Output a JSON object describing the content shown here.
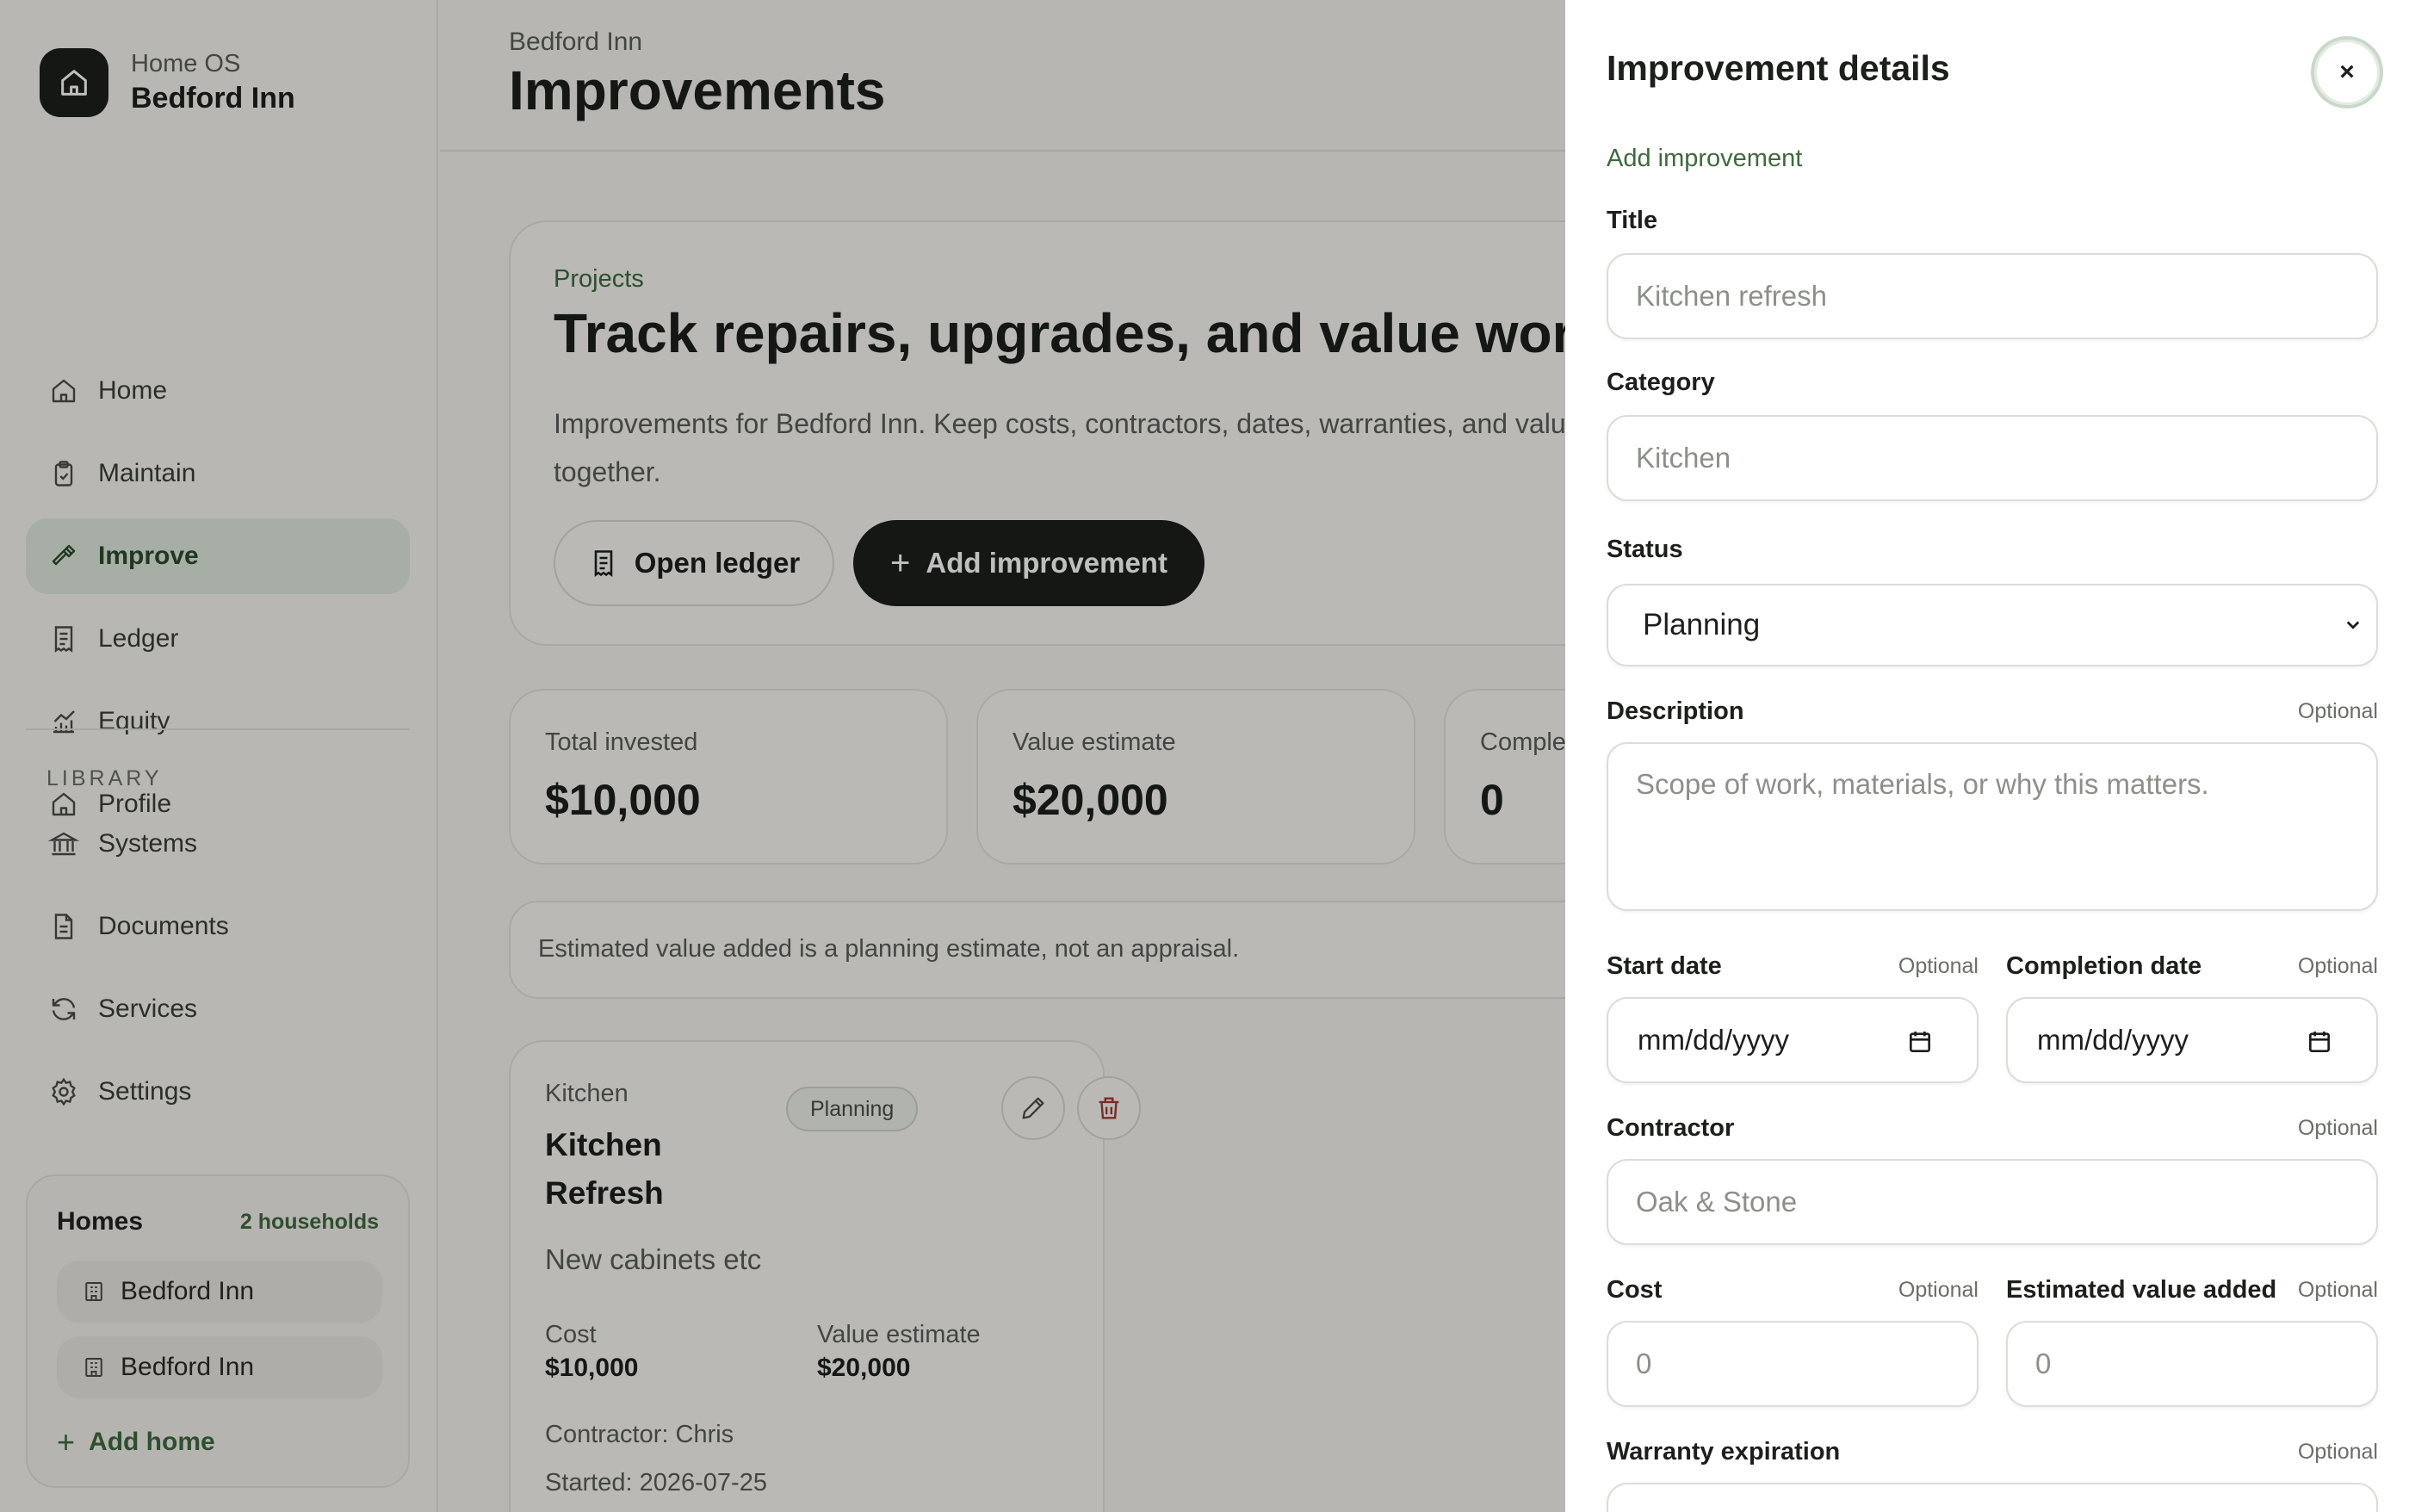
{
  "brand": {
    "kicker": "Home OS",
    "name": "Bedford Inn"
  },
  "nav": {
    "items": [
      {
        "label": "Home",
        "icon": "home-icon"
      },
      {
        "label": "Maintain",
        "icon": "clipboard-icon"
      },
      {
        "label": "Improve",
        "icon": "hammer-icon",
        "active": true
      },
      {
        "label": "Ledger",
        "icon": "receipt-icon"
      },
      {
        "label": "Equity",
        "icon": "chart-icon"
      },
      {
        "label": "Profile",
        "icon": "home-icon"
      }
    ],
    "library_label": "LIBRARY",
    "library": [
      {
        "label": "Systems",
        "icon": "bank-icon"
      },
      {
        "label": "Documents",
        "icon": "document-icon"
      },
      {
        "label": "Services",
        "icon": "refresh-icon"
      },
      {
        "label": "Settings",
        "icon": "gear-icon"
      }
    ]
  },
  "homes": {
    "title": "Homes",
    "count": "2 households",
    "items": [
      "Bedford Inn",
      "Bedford Inn"
    ],
    "add_label": "Add home"
  },
  "header": {
    "breadcrumb": "Bedford Inn",
    "title": "Improvements"
  },
  "hero": {
    "kicker": "Projects",
    "title": "Track repairs, upgrades, and value work.",
    "description": "Improvements for Bedford Inn. Keep costs, contractors, dates, warranties, and value estimates together.",
    "open_ledger_label": "Open ledger",
    "add_label": "Add improvement"
  },
  "stats": [
    {
      "label": "Total invested",
      "value": "$10,000"
    },
    {
      "label": "Value estimate",
      "value": "$20,000"
    },
    {
      "label": "Completed",
      "value": "0"
    }
  ],
  "disclaimer": "Estimated value added is a planning estimate, not an appraisal.",
  "project": {
    "category": "Kitchen",
    "title": "Kitchen Refresh",
    "status": "Planning",
    "description": "New cabinets etc",
    "cost_label": "Cost",
    "cost": "$10,000",
    "value_label": "Value estimate",
    "value": "$20,000",
    "contractor": "Contractor: Chris",
    "started": "Started: 2026-07-25"
  },
  "drawer": {
    "title": "Improvement details",
    "close_label": "×",
    "subtitle": "Add improvement",
    "optional": "Optional",
    "fields": {
      "title": {
        "label": "Title",
        "placeholder": "Kitchen refresh"
      },
      "category": {
        "label": "Category",
        "placeholder": "Kitchen"
      },
      "status": {
        "label": "Status",
        "value": "Planning"
      },
      "description": {
        "label": "Description",
        "placeholder": "Scope of work, materials, or why this matters."
      },
      "start_date": {
        "label": "Start date",
        "value": "mm/dd/yyyy"
      },
      "completion_date": {
        "label": "Completion date",
        "value": "mm/dd/yyyy"
      },
      "contractor": {
        "label": "Contractor",
        "placeholder": "Oak & Stone"
      },
      "cost": {
        "label": "Cost",
        "placeholder": "0"
      },
      "value_added": {
        "label": "Estimated value added",
        "placeholder": "0"
      },
      "warranty": {
        "label": "Warranty expiration"
      }
    }
  },
  "colors": {
    "accent": "#3e6a3e",
    "active_bg": "#dfe8dc",
    "dark": "#1d1f1c"
  }
}
